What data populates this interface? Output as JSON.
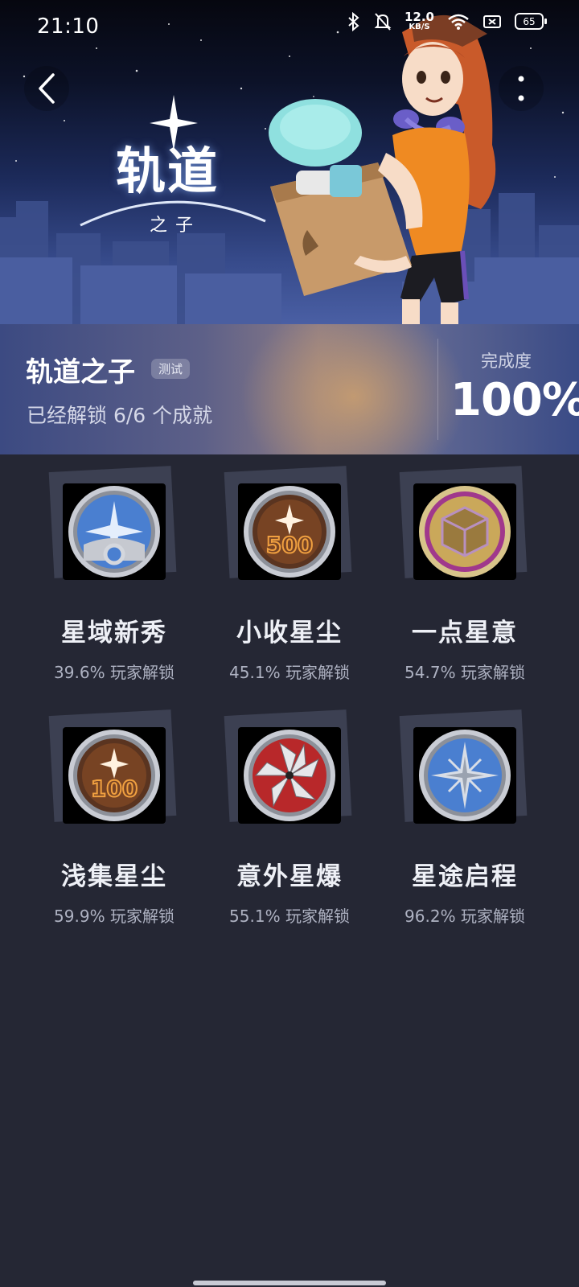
{
  "status_bar": {
    "time": "21:10",
    "net_speed_value": "12.0",
    "net_speed_unit": "KB/S",
    "battery": "65",
    "icons": [
      "bluetooth-icon",
      "silent-bell-icon",
      "wifi-icon",
      "sim-off-icon",
      "battery-icon"
    ]
  },
  "nav": {
    "back_icon": "chevron-left-icon",
    "more_icon": "more-vertical-icon"
  },
  "banner": {
    "logo_main": "轨道",
    "logo_sub": "之子"
  },
  "header": {
    "title": "轨道之子",
    "badge": "测试",
    "unlock_text": "已经解锁 6/6 个成就",
    "completion_label": "完成度",
    "completion_value": "100%"
  },
  "achievements": [
    {
      "name": "星域新秀",
      "rate": "39.6% 玩家解锁",
      "icon": "blue-star-ring-medal-icon"
    },
    {
      "name": "小收星尘",
      "rate": "45.1% 玩家解锁",
      "icon": "bronze-500-medal-icon"
    },
    {
      "name": "一点星意",
      "rate": "54.7% 玩家解锁",
      "icon": "gold-cube-medal-icon"
    },
    {
      "name": "浅集星尘",
      "rate": "59.9% 玩家解锁",
      "icon": "bronze-100-medal-icon"
    },
    {
      "name": "意外星爆",
      "rate": "55.1% 玩家解锁",
      "icon": "red-burst-medal-icon"
    },
    {
      "name": "星途启程",
      "rate": "96.2% 玩家解锁",
      "icon": "blue-compass-star-medal-icon"
    }
  ],
  "colors": {
    "background": "#252734",
    "title_text": "#eef0f6",
    "rate_text": "#aeb2c2",
    "banner_top": "#06070f",
    "banner_bottom": "#4a5fa4"
  }
}
